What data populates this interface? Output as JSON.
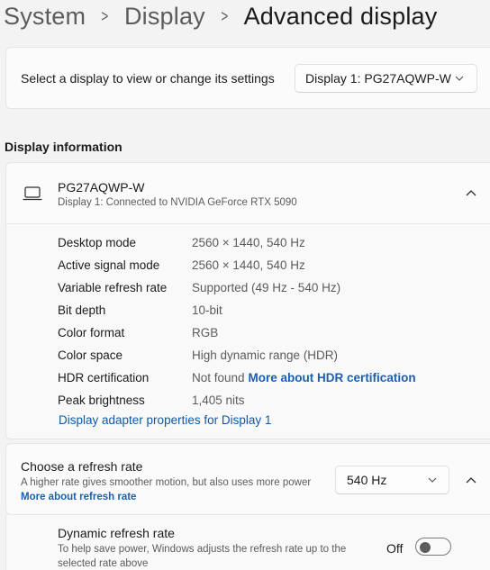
{
  "breadcrumb": {
    "items": [
      "System",
      "Display"
    ],
    "current": "Advanced display"
  },
  "select_display": {
    "label": "Select a display to view or change its settings",
    "selected": "Display 1: PG27AQWP-W"
  },
  "display_info": {
    "section_title": "Display information",
    "monitor_name": "PG27AQWP-W",
    "monitor_subtitle": "Display 1: Connected to NVIDIA GeForce RTX 5090",
    "rows": [
      {
        "key": "Desktop mode",
        "value": "2560 × 1440, 540 Hz"
      },
      {
        "key": "Active signal mode",
        "value": "2560 × 1440, 540 Hz"
      },
      {
        "key": "Variable refresh rate",
        "value": "Supported (49 Hz - 540 Hz)"
      },
      {
        "key": "Bit depth",
        "value": "10-bit"
      },
      {
        "key": "Color format",
        "value": "RGB"
      },
      {
        "key": "Color space",
        "value": "High dynamic range (HDR)"
      },
      {
        "key": "HDR certification",
        "value": "Not found",
        "link": "More about HDR certification"
      },
      {
        "key": "Peak brightness",
        "value": "1,405 nits"
      }
    ],
    "adapter_link": "Display adapter properties for Display 1"
  },
  "refresh_rate": {
    "title": "Choose a refresh rate",
    "description": "A higher rate gives smoother motion, but also uses more power",
    "link": "More about refresh rate",
    "selected": "540 Hz"
  },
  "dynamic_refresh": {
    "title": "Dynamic refresh rate",
    "description": "To help save power, Windows adjusts the refresh rate up to the selected rate above",
    "toggle_state": "Off"
  },
  "icons": {
    "breadcrumb_separator": "chevron-right-icon",
    "monitor": "laptop-icon",
    "dropdown": "chevron-down-icon",
    "collapse": "chevron-up-icon"
  },
  "colors": {
    "accent_link": "#1a5fb4",
    "background": "#f3f3f3",
    "card": "#fbfbfb"
  }
}
